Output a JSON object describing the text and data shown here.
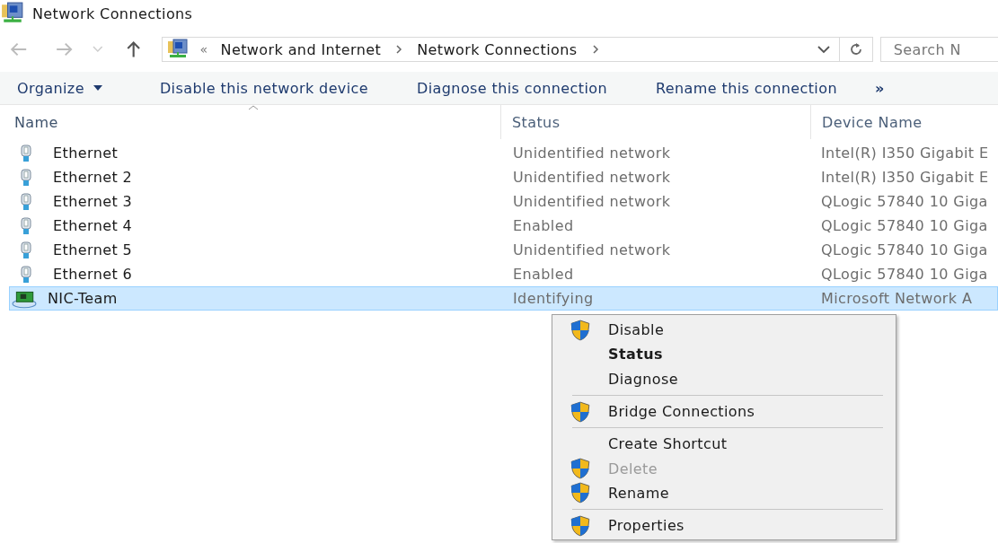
{
  "window": {
    "title": "Network Connections"
  },
  "address_bar": {
    "overflow": "«",
    "segments": [
      "Network and Internet",
      "Network Connections"
    ]
  },
  "search": {
    "placeholder": "Search N"
  },
  "toolbar": {
    "organize": "Organize",
    "commands": [
      "Disable this network device",
      "Diagnose this connection",
      "Rename this connection"
    ],
    "more": "»"
  },
  "table": {
    "columns": [
      {
        "label": "Name",
        "sorted": true
      },
      {
        "label": "Status",
        "sorted": false
      },
      {
        "label": "Device Name",
        "sorted": false
      }
    ],
    "rows": [
      {
        "kind": "ethernet",
        "name": "Ethernet",
        "status": "Unidentified network",
        "device": "Intel(R) I350 Gigabit E",
        "selected": false
      },
      {
        "kind": "ethernet",
        "name": "Ethernet 2",
        "status": "Unidentified network",
        "device": "Intel(R) I350 Gigabit E",
        "selected": false
      },
      {
        "kind": "ethernet",
        "name": "Ethernet 3",
        "status": "Unidentified network",
        "device": "QLogic 57840 10 Giga",
        "selected": false
      },
      {
        "kind": "ethernet",
        "name": "Ethernet 4",
        "status": "Enabled",
        "device": "QLogic 57840 10 Giga",
        "selected": false
      },
      {
        "kind": "ethernet",
        "name": "Ethernet 5",
        "status": "Unidentified network",
        "device": "QLogic 57840 10 Giga",
        "selected": false
      },
      {
        "kind": "ethernet",
        "name": "Ethernet 6",
        "status": "Enabled",
        "device": "QLogic 57840 10 Giga",
        "selected": false
      },
      {
        "kind": "team",
        "name": "NIC-Team",
        "status": "Identifying",
        "device": "Microsoft Network A",
        "selected": true
      }
    ]
  },
  "context_menu": {
    "items": [
      {
        "kind": "item",
        "label": "Disable",
        "shield": true,
        "bold": false,
        "disabled": false
      },
      {
        "kind": "item",
        "label": "Status",
        "shield": false,
        "bold": true,
        "disabled": false
      },
      {
        "kind": "item",
        "label": "Diagnose",
        "shield": false,
        "bold": false,
        "disabled": false
      },
      {
        "kind": "separator"
      },
      {
        "kind": "item",
        "label": "Bridge Connections",
        "shield": true,
        "bold": false,
        "disabled": false
      },
      {
        "kind": "separator"
      },
      {
        "kind": "item",
        "label": "Create Shortcut",
        "shield": false,
        "bold": false,
        "disabled": false
      },
      {
        "kind": "item",
        "label": "Delete",
        "shield": true,
        "bold": false,
        "disabled": true
      },
      {
        "kind": "item",
        "label": "Rename",
        "shield": true,
        "bold": false,
        "disabled": false
      },
      {
        "kind": "separator"
      },
      {
        "kind": "item",
        "label": "Properties",
        "shield": true,
        "bold": false,
        "disabled": false
      }
    ]
  }
}
